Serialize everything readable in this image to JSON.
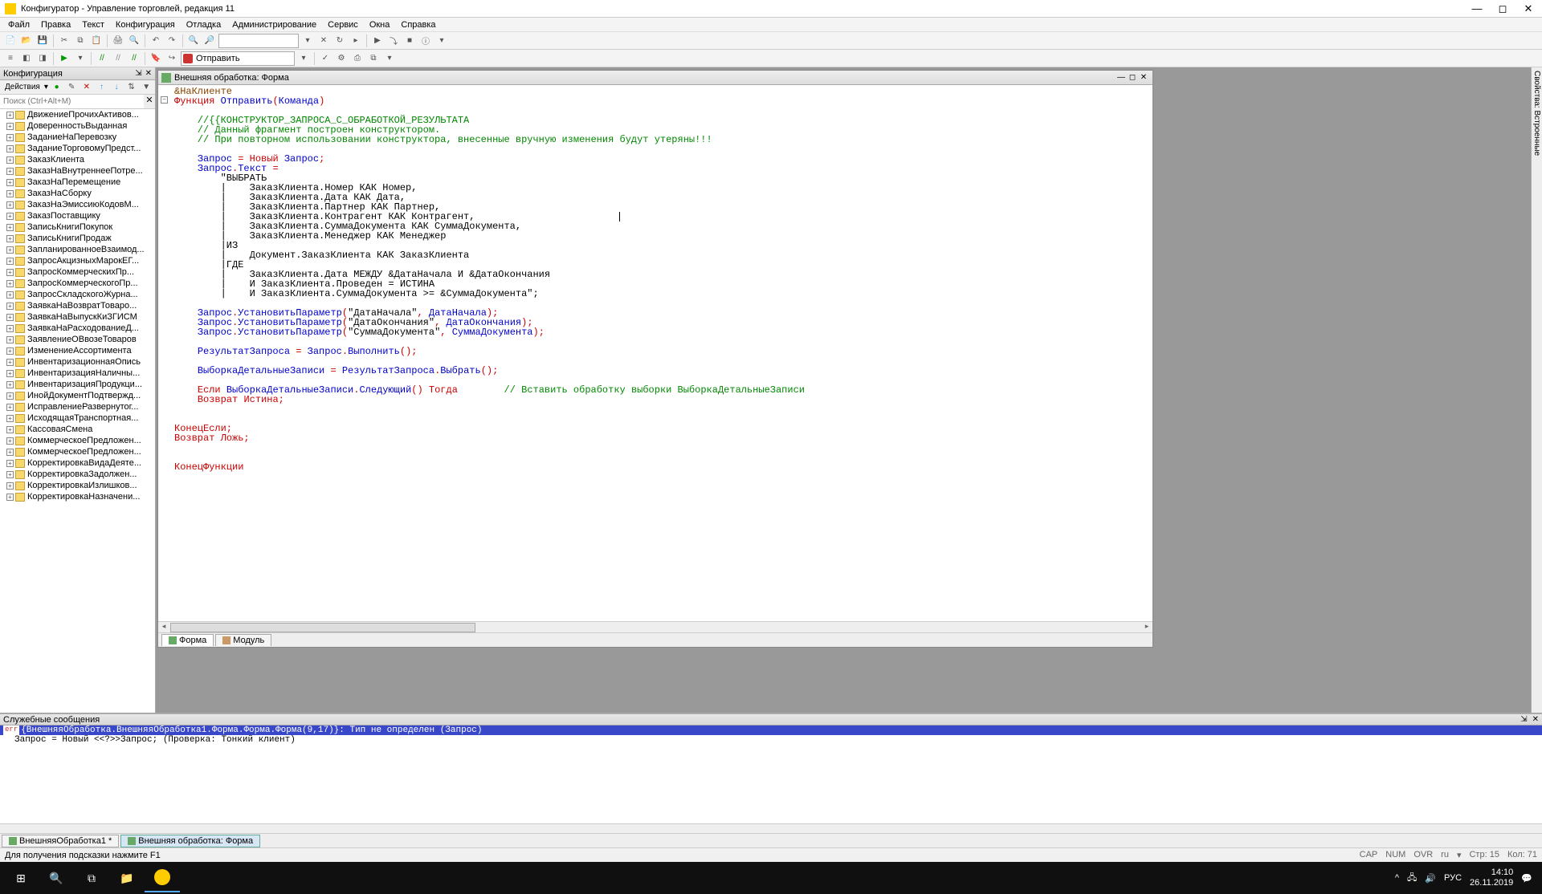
{
  "window": {
    "title": "Конфигуратор - Управление торговлей, редакция 11"
  },
  "menu": [
    "Файл",
    "Правка",
    "Текст",
    "Конфигурация",
    "Отладка",
    "Администрирование",
    "Сервис",
    "Окна",
    "Справка"
  ],
  "toolbar2": {
    "combo_label": "Отправить"
  },
  "left": {
    "panel_title": "Конфигурация",
    "actions_label": "Действия",
    "search_placeholder": "Поиск (Ctrl+Alt+M)",
    "items": [
      "ДвижениеПрочихАктивов...",
      "ДоверенностьВыданная",
      "ЗаданиеНаПеревозку",
      "ЗаданиеТорговомуПредст...",
      "ЗаказКлиента",
      "ЗаказНаВнутреннееПотре...",
      "ЗаказНаПеремещение",
      "ЗаказНаСборку",
      "ЗаказНаЭмиссиюКодовМ...",
      "ЗаказПоставщику",
      "ЗаписьКнигиПокупок",
      "ЗаписьКнигиПродаж",
      "ЗапланированноеВзаимод...",
      "ЗапросАкцизныхМарокЕГ...",
      "ЗапросКоммерческихПр...",
      "ЗапросКоммерческогоПр...",
      "ЗапросСкладскогоЖурна...",
      "ЗаявкаНаВозвратТоваро...",
      "ЗаявкаНаВыпускКиЗГИСМ",
      "ЗаявкаНаРасходованиеД...",
      "ЗаявлениеОВвозеТоваров",
      "ИзменениеАссортимента",
      "ИнвентаризационнаяОпись",
      "ИнвентаризацияНаличны...",
      "ИнвентаризацияПродукци...",
      "ИнойДокументПодтвержд...",
      "ИсправлениеРазвернутог...",
      "ИсходящаяТранспортная...",
      "КассоваяСмена",
      "КоммерческоеПредложен...",
      "КоммерческоеПредложен...",
      "КорректировкаВидаДеяте...",
      "КорректировкаЗадолжен...",
      "КорректировкаИзлишков...",
      "КорректировкаНазначени..."
    ]
  },
  "editor": {
    "child_title": "Внешняя обработка: Форма",
    "tabs": {
      "form": "Форма",
      "module": "Модуль"
    },
    "code_lines": [
      {
        "t": "directive",
        "s": "&НаКлиенте"
      },
      {
        "t": "func",
        "s": "Функция Отправить(Команда)"
      },
      {
        "t": "blank",
        "s": ""
      },
      {
        "t": "comment",
        "s": "    //{{КОНСТРУКТОР_ЗАПРОСА_С_ОБРАБОТКОЙ_РЕЗУЛЬТАТА"
      },
      {
        "t": "comment",
        "s": "    // Данный фрагмент построен конструктором."
      },
      {
        "t": "comment",
        "s": "    // При повторном использовании конструктора, внесенные вручную изменения будут утеряны!!!"
      },
      {
        "t": "blank",
        "s": ""
      },
      {
        "t": "assign",
        "s": "    Запрос = Новый Запрос;"
      },
      {
        "t": "assign2",
        "s": "    Запрос.Текст = "
      },
      {
        "t": "str",
        "s": "        \"ВЫБРАТЬ"
      },
      {
        "t": "str",
        "s": "        |    ЗаказКлиента.Номер КАК Номер,"
      },
      {
        "t": "str",
        "s": "        |    ЗаказКлиента.Дата КАК Дата,"
      },
      {
        "t": "str",
        "s": "        |    ЗаказКлиента.Партнер КАК Партнер,"
      },
      {
        "t": "strcur",
        "s": "        |    ЗаказКлиента.Контрагент КАК Контрагент,"
      },
      {
        "t": "str",
        "s": "        |    ЗаказКлиента.СуммаДокумента КАК СуммаДокумента,"
      },
      {
        "t": "str",
        "s": "        |    ЗаказКлиента.Менеджер КАК Менеджер"
      },
      {
        "t": "str",
        "s": "        |ИЗ"
      },
      {
        "t": "str",
        "s": "        |    Документ.ЗаказКлиента КАК ЗаказКлиента"
      },
      {
        "t": "str",
        "s": "        |ГДЕ"
      },
      {
        "t": "str",
        "s": "        |    ЗаказКлиента.Дата МЕЖДУ &ДатаНачала И &ДатаОкончания"
      },
      {
        "t": "str",
        "s": "        |    И ЗаказКлиента.Проведен = ИСТИНА"
      },
      {
        "t": "str",
        "s": "        |    И ЗаказКлиента.СуммаДокумента >= &СуммаДокумента\";"
      },
      {
        "t": "blank",
        "s": ""
      },
      {
        "t": "param",
        "s": "    Запрос.УстановитьПараметр(\"ДатаНачала\", ДатаНачала);"
      },
      {
        "t": "param",
        "s": "    Запрос.УстановитьПараметр(\"ДатаОкончания\", ДатаОкончания);"
      },
      {
        "t": "param",
        "s": "    Запрос.УстановитьПараметр(\"СуммаДокумента\", СуммаДокумента);"
      },
      {
        "t": "blank",
        "s": ""
      },
      {
        "t": "assign3",
        "s": "    РезультатЗапроса = Запрос.Выполнить();"
      },
      {
        "t": "blank",
        "s": ""
      },
      {
        "t": "assign3",
        "s": "    ВыборкаДетальныеЗаписи = РезультатЗапроса.Выбрать();"
      },
      {
        "t": "blank",
        "s": ""
      },
      {
        "t": "if",
        "s": "    Если ВыборкаДетальныеЗаписи.Следующий() Тогда        // Вставить обработку выборки ВыборкаДетальныеЗаписи"
      },
      {
        "t": "ret",
        "s": "    Возврат Истина;"
      },
      {
        "t": "blank",
        "s": ""
      },
      {
        "t": "blank",
        "s": ""
      },
      {
        "t": "endif",
        "s": "КонецЕсли;"
      },
      {
        "t": "ret2",
        "s": "Возврат Ложь;"
      },
      {
        "t": "blank",
        "s": ""
      },
      {
        "t": "blank",
        "s": ""
      },
      {
        "t": "endfunc",
        "s": "КонецФункции"
      }
    ]
  },
  "rightdock": {
    "label": "Свойства: Встроенные"
  },
  "messages": {
    "title": "Служебные сообщения",
    "err_prefix": "err",
    "err_line": "{ВнешняяОбработка.ВнешняяОбработка1.Форма.Форма.Форма(9,17)}: Тип не определен (Запрос)",
    "detail": "    Запрос = Новый <<?>>Запрос; (Проверка: Тонкий клиент)"
  },
  "doctabs": [
    {
      "label": "ВнешняяОбработка1 *",
      "active": false
    },
    {
      "label": "Внешняя обработка: Форма",
      "active": true
    }
  ],
  "status": {
    "hint": "Для получения подсказки нажмите F1",
    "cap": "CAP",
    "num": "NUM",
    "ovr": "OVR",
    "lang": "ru",
    "row": "Стр: 15",
    "col": "Кол: 71"
  },
  "taskbar": {
    "lang": "РУС",
    "time": "14:10",
    "date": "26.11.2019"
  }
}
